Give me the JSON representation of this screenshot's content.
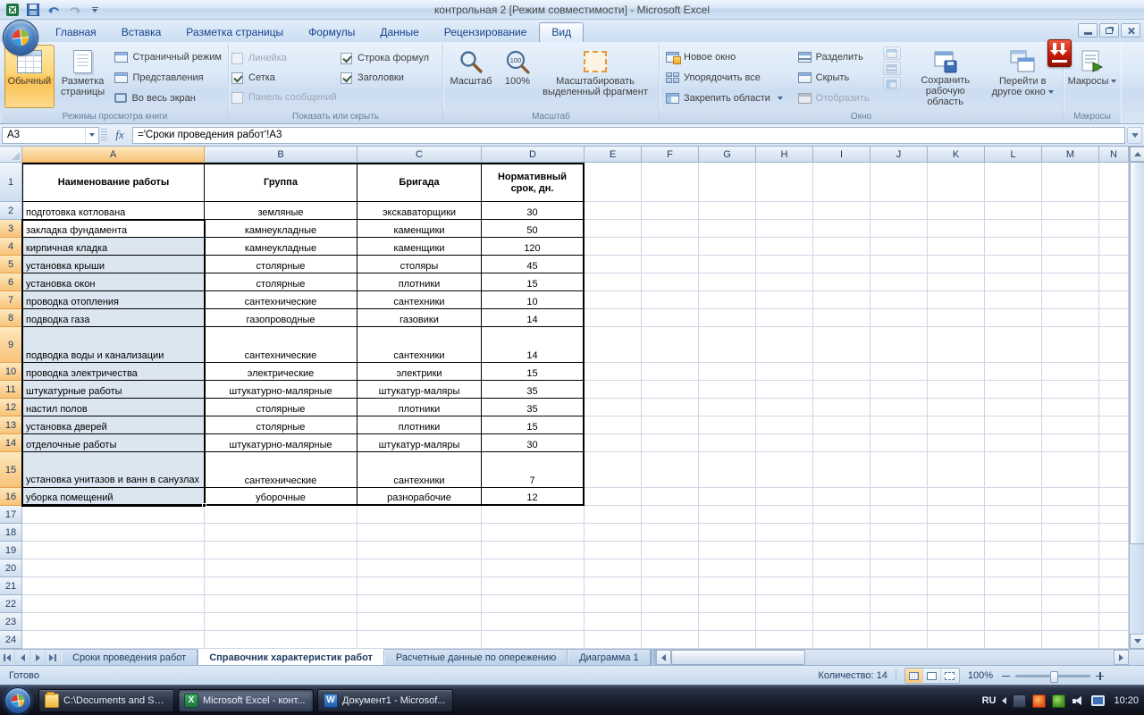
{
  "window": {
    "title": "контрольная 2  [Режим совместимости] - Microsoft Excel"
  },
  "ribbon": {
    "tabs": [
      "Главная",
      "Вставка",
      "Разметка страницы",
      "Формулы",
      "Данные",
      "Рецензирование",
      "Вид"
    ],
    "active_tab_index": 6,
    "groups": {
      "views": {
        "label": "Режимы просмотра книги",
        "normal": "Обычный",
        "page_layout": "Разметка страницы",
        "page_break": "Страничный режим",
        "custom_views": "Представления",
        "full_screen": "Во весь экран"
      },
      "show_hide": {
        "label": "Показать или скрыть",
        "ruler": "Линейка",
        "gridlines": "Сетка",
        "message_bar": "Панель сообщений",
        "formula_bar": "Строка формул",
        "headings": "Заголовки"
      },
      "zoom": {
        "label": "Масштаб",
        "zoom": "Масштаб",
        "hundred": "100%",
        "zoom_selection": "Масштабировать выделенный фрагмент"
      },
      "win": {
        "label": "Окно",
        "new_window": "Новое окно",
        "arrange_all": "Упорядочить все",
        "freeze_panes": "Закрепить области",
        "split": "Разделить",
        "hide": "Скрыть",
        "unhide": "Отобразить",
        "save_workspace": "Сохранить рабочую область",
        "switch_windows": "Перейти в другое окно"
      },
      "macros": {
        "label": "Макросы",
        "macros": "Макросы"
      }
    }
  },
  "formula_bar": {
    "name_box": "A3",
    "fx": "fx",
    "formula": "='Сроки проведения работ'!A3"
  },
  "grid": {
    "columns": [
      "A",
      "B",
      "C",
      "D",
      "E",
      "F",
      "G",
      "H",
      "I",
      "J",
      "K",
      "L",
      "M",
      "N"
    ],
    "rows_visible": 24,
    "selection": {
      "range": "A3:A16",
      "active_cell": "A3"
    },
    "table": {
      "header": [
        "Наименование работы",
        "Группа",
        "Бригада",
        "Нормативный срок, дн."
      ],
      "rows": [
        [
          "подготовка котлована",
          "земляные",
          "экскаваторщики",
          "30"
        ],
        [
          "закладка фундамента",
          "камнеукладные",
          "каменщики",
          "50"
        ],
        [
          "кирпичная кладка",
          "камнеукладные",
          "каменщики",
          "120"
        ],
        [
          "установка крыши",
          "столярные",
          "столяры",
          "45"
        ],
        [
          "установка окон",
          "столярные",
          "плотники",
          "15"
        ],
        [
          "проводка отопления",
          "сантехнические",
          "сантехники",
          "10"
        ],
        [
          "подводка газа",
          "газопроводные",
          "газовики",
          "14"
        ],
        [
          "подводка воды и канализации",
          "сантехнические",
          "сантехники",
          "14"
        ],
        [
          "проводка электричества",
          "электрические",
          "электрики",
          "15"
        ],
        [
          "штукатурные работы",
          "штукатурно-малярные",
          "штукатур-маляры",
          "35"
        ],
        [
          "настил полов",
          "столярные",
          "плотники",
          "35"
        ],
        [
          "установка дверей",
          "столярные",
          "плотники",
          "15"
        ],
        [
          "отделочные работы",
          "штукатурно-малярные",
          "штукатур-маляры",
          "30"
        ],
        [
          "установка унитазов и ванн в санузлах",
          "сантехнические",
          "сантехники",
          "7"
        ],
        [
          "уборка помещений",
          "уборочные",
          "разнорабочие",
          "12"
        ]
      ]
    }
  },
  "sheet_tabs": {
    "tabs": [
      "Сроки проведения работ",
      "Справочник характеристик работ",
      "Расчетные данные по опережению",
      "Диаграмма 1"
    ],
    "active_index": 1
  },
  "status_bar": {
    "mode": "Готово",
    "count": "Количество: 14",
    "zoom": "100%"
  },
  "taskbar": {
    "tasks": [
      "C:\\Documents and Set...",
      "Microsoft Excel - конт...",
      "Документ1 - Microsof..."
    ],
    "active_task_index": 1,
    "language": "RU",
    "time": "10:20"
  }
}
